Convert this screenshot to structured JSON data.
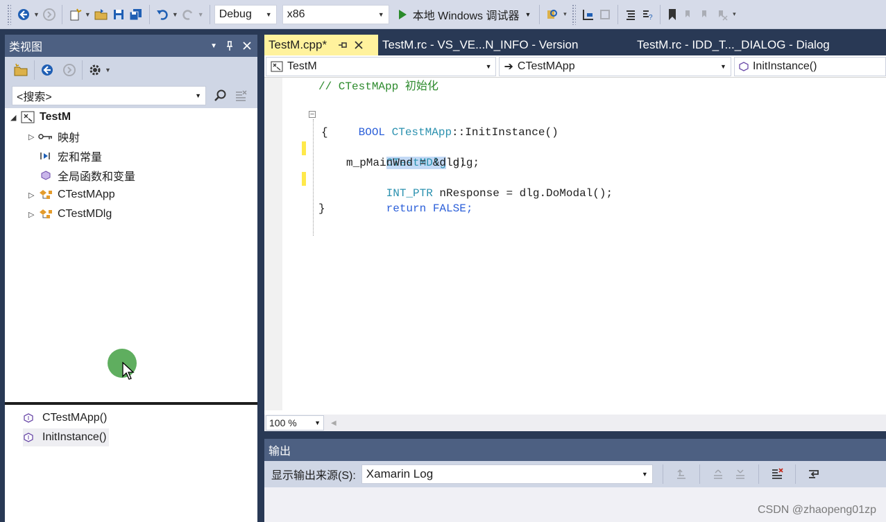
{
  "toolbar": {
    "config": "Debug",
    "platform": "x86",
    "run_label": "本地 Windows 调试器"
  },
  "class_view": {
    "title": "类视图",
    "search_placeholder": "<搜索>",
    "tree": {
      "root": "TestM",
      "items": [
        {
          "label": "映射"
        },
        {
          "label": "宏和常量"
        },
        {
          "label": "全局函数和变量"
        },
        {
          "label": "CTestMApp"
        },
        {
          "label": "CTestMDlg"
        }
      ]
    },
    "members": [
      {
        "label": "CTestMApp()"
      },
      {
        "label": "InitInstance()"
      }
    ]
  },
  "editor": {
    "tabs": [
      {
        "label": "TestM.cpp*"
      },
      {
        "label": "TestM.rc - VS_VE...N_INFO - Version"
      },
      {
        "label": "TestM.rc - IDD_T..._DIALOG - Dialog"
      }
    ],
    "nav": {
      "project": "TestM",
      "class": "CTestMApp",
      "member": "InitInstance()"
    },
    "code": {
      "comment": "// CTestMApp 初始化",
      "l1_kw": "BOOL",
      "l1_cls": "CTestMApp",
      "l1_rest": "::InitInstance()",
      "l2": "{",
      "l3_cls": "CTestMDlg",
      "l3_rest": " dlg;",
      "l4": "m_pMainWnd = &dlg;",
      "l5_type": "INT_PTR",
      "l5_rest": " nResponse = dlg.DoModal();",
      "l6_kw": "return",
      "l6_rest": " FALSE;",
      "l7": "}"
    },
    "zoom": "100 %"
  },
  "output": {
    "title": "输出",
    "source_label": "显示输出来源(S):",
    "source_value": "Xamarin Log"
  },
  "watermark": "CSDN @zhaopeng01zp"
}
